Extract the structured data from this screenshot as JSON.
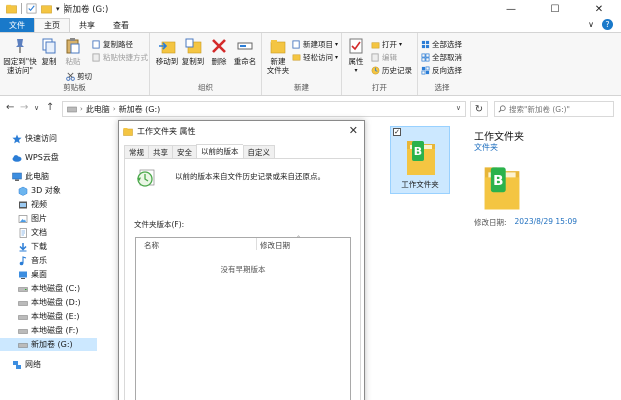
{
  "window": {
    "title": "新加卷 (G:)",
    "controls": {
      "minimize": "—",
      "maximize": "☐",
      "close": "✕"
    }
  },
  "tabs": [
    "文件",
    "主页",
    "共享",
    "查看"
  ],
  "tabs_right": {
    "chevron": "∨",
    "help": "?"
  },
  "ribbon": {
    "clipboard": {
      "label": "剪贴板",
      "pin": "固定到\"快\n速访问\"",
      "copy": "复制",
      "paste": "粘贴",
      "copy_path": "复制路径",
      "paste_shortcut": "粘贴快捷方式",
      "cut": "剪切"
    },
    "organize": {
      "label": "组织",
      "move_to": "移动到",
      "copy_to": "复制到",
      "delete": "删除",
      "rename": "重命名"
    },
    "new": {
      "label": "新建",
      "new_folder": "新建\n文件夹",
      "new_item": "新建项目",
      "easy_access": "轻松访问"
    },
    "open": {
      "label": "打开",
      "properties": "属性",
      "open": "打开",
      "edit": "编辑",
      "history": "历史记录"
    },
    "select": {
      "label": "选择",
      "select_all": "全部选择",
      "select_none": "全部取消",
      "invert": "反向选择"
    }
  },
  "address": {
    "back": "←",
    "forward": "→",
    "recent": "∨",
    "up": "↑",
    "crumbs": [
      "此电脑",
      "新加卷 (G:)"
    ],
    "dropdown": "∨",
    "refresh": "↻",
    "search_placeholder": "搜索\"新加卷 (G:)\""
  },
  "sidebar": {
    "items": [
      {
        "label": "快速访问"
      },
      {
        "label": "WPS云盘"
      },
      {
        "label": "此电脑"
      },
      {
        "label": "3D 对象"
      },
      {
        "label": "视频"
      },
      {
        "label": "图片"
      },
      {
        "label": "文档"
      },
      {
        "label": "下载"
      },
      {
        "label": "音乐"
      },
      {
        "label": "桌面"
      },
      {
        "label": "本地磁盘 (C:)"
      },
      {
        "label": "本地磁盘 (D:)"
      },
      {
        "label": "本地磁盘 (E:)"
      },
      {
        "label": "本地磁盘 (F:)"
      },
      {
        "label": "新加卷 (G:)"
      },
      {
        "label": "网络"
      }
    ]
  },
  "content": {
    "item_name": "工作文件夹",
    "check": "✓"
  },
  "details": {
    "title": "工作文件夹",
    "type": "文件夹",
    "modified_label": "修改日期:",
    "modified_value": "2023/8/29 15:09"
  },
  "dialog": {
    "title": "工作文件夹 属性",
    "close": "✕",
    "tabs": [
      "常规",
      "共享",
      "安全",
      "以前的版本",
      "自定义"
    ],
    "description": "以前的版本来自文件历史记录或来自还原点。",
    "versions_label": "文件夹版本(F):",
    "columns": {
      "name": "名称",
      "modified": "修改日期"
    },
    "empty_text": "没有早期版本"
  },
  "colors": {
    "accent": "#1979ca",
    "selection": "#cce8ff",
    "folder": "#f4c542",
    "wps_green": "#2bb24c",
    "link": "#1f6fbf"
  }
}
